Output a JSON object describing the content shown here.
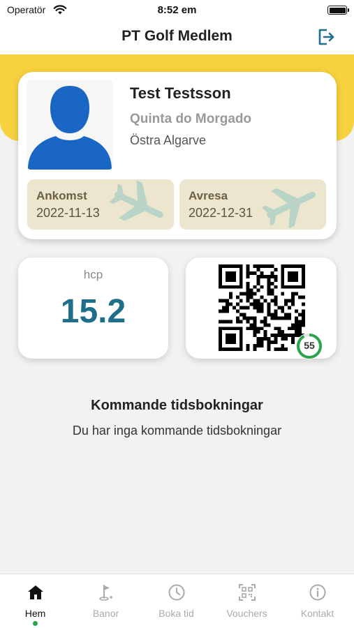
{
  "status_bar": {
    "carrier": "Operatör",
    "time": "8:52 em",
    "icons": [
      "wifi-icon",
      "battery-icon"
    ]
  },
  "header": {
    "title": "PT Golf Medlem",
    "logout_icon": "logout-icon"
  },
  "colors": {
    "accent_yellow": "#f7d23e",
    "hcp_blue": "#1f6f8b",
    "active_green": "#2ca54a",
    "date_box_bg": "#ede6cf"
  },
  "profile": {
    "name": "Test Testsson",
    "club": "Quinta do Morgado",
    "region": "Östra Algarve",
    "arrival": {
      "label": "Ankomst",
      "date": "2022-11-13"
    },
    "departure": {
      "label": "Avresa",
      "date": "2022-12-31"
    }
  },
  "handicap": {
    "label": "hcp",
    "value": "15.2"
  },
  "qr": {
    "countdown": "55",
    "countdown_fraction": 0.92
  },
  "upcoming": {
    "title": "Kommande tidsbokningar",
    "empty_text": "Du har inga kommande tidsbokningar"
  },
  "tabs": [
    {
      "label": "Hem",
      "icon": "home-icon",
      "active": true
    },
    {
      "label": "Banor",
      "icon": "golf-flag-icon",
      "active": false
    },
    {
      "label": "Boka tid",
      "icon": "clock-icon",
      "active": false
    },
    {
      "label": "Vouchers",
      "icon": "qr-code-icon",
      "active": false
    },
    {
      "label": "Kontakt",
      "icon": "info-icon",
      "active": false
    }
  ]
}
